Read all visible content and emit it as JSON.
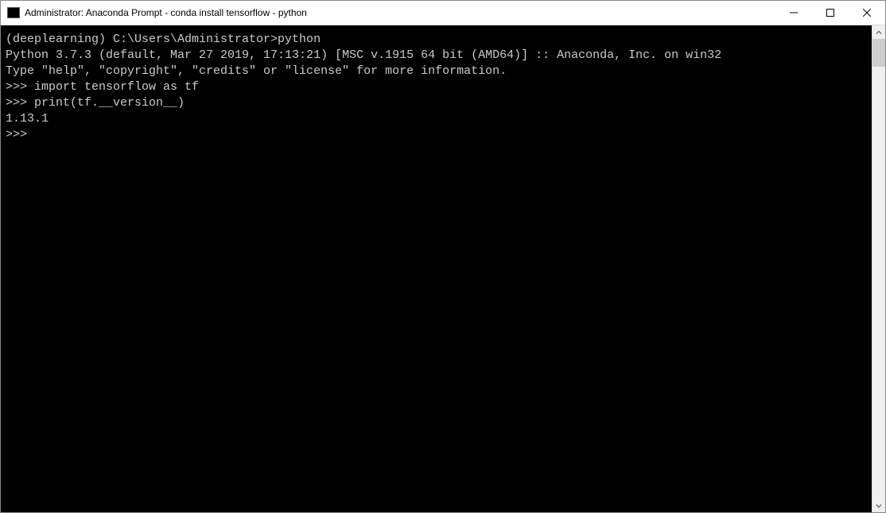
{
  "window": {
    "title": "Administrator: Anaconda Prompt - conda  install tensorflow - python"
  },
  "terminal": {
    "lines": [
      "",
      "(deeplearning) C:\\Users\\Administrator>python",
      "Python 3.7.3 (default, Mar 27 2019, 17:13:21) [MSC v.1915 64 bit (AMD64)] :: Anaconda, Inc. on win32",
      "Type \"help\", \"copyright\", \"credits\" or \"license\" for more information.",
      ">>> import tensorflow as tf",
      ">>> print(tf.__version__)",
      "1.13.1",
      ">>>"
    ]
  }
}
